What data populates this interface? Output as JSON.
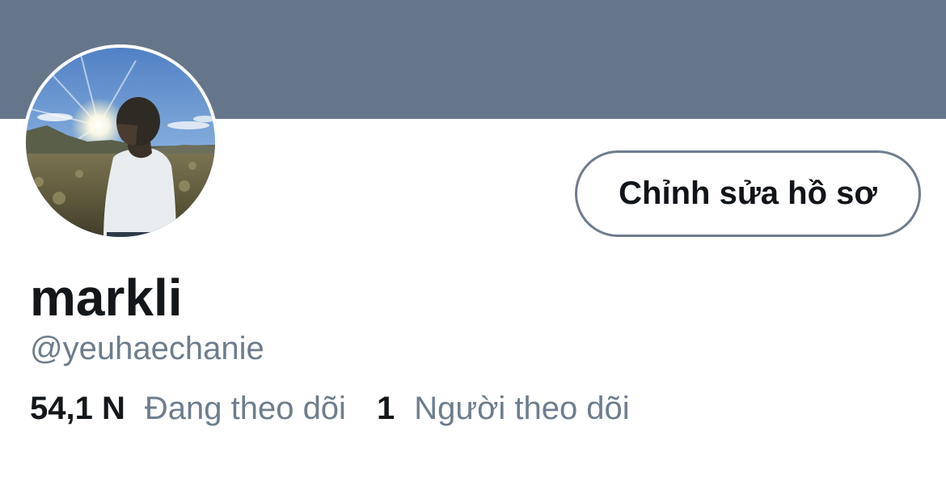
{
  "profile": {
    "display_name": "markli",
    "handle": "@yeuhaechanie",
    "edit_button_label": "Chỉnh sửa hồ sơ",
    "avatar_icon": "profile-photo-sunset-person",
    "banner_color": "#66768a"
  },
  "stats": {
    "following_count": "54,1 N",
    "following_label": "Đang theo dõi",
    "followers_count": "1",
    "followers_label": "Người theo dõi"
  }
}
